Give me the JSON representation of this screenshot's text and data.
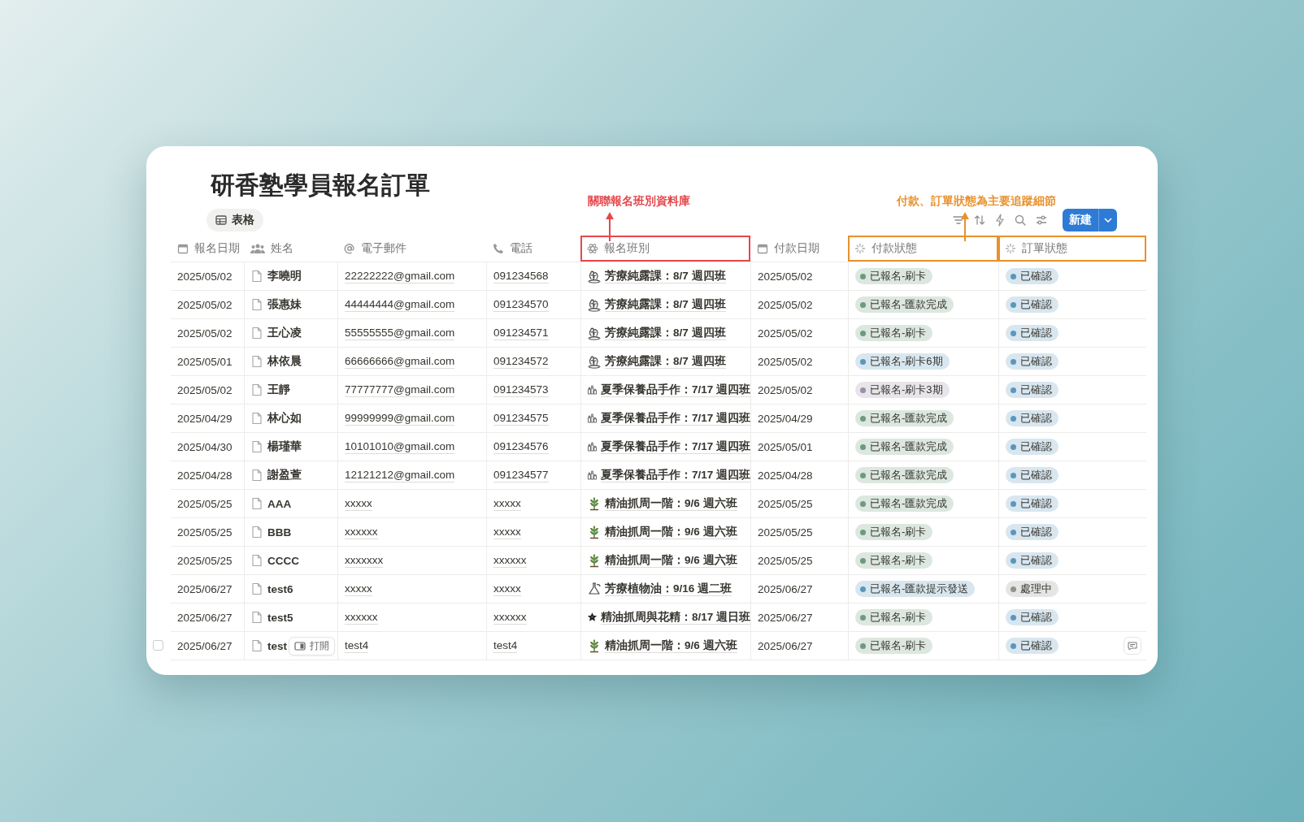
{
  "title": "研香塾學員報名訂單",
  "view_tab": {
    "label": "表格",
    "selected": true
  },
  "annotations": [
    {
      "text": "關聯報名班別資料庫",
      "color": "#e5484d"
    },
    {
      "text": "付款、訂單狀態為主要追蹤細節",
      "color": "#e8912d"
    }
  ],
  "new_button": {
    "label": "新建"
  },
  "columns": [
    {
      "label": "報名日期",
      "kind": "date"
    },
    {
      "label": "姓名",
      "kind": "person"
    },
    {
      "label": "電子郵件",
      "kind": "email"
    },
    {
      "label": "電話",
      "kind": "phone"
    },
    {
      "label": "報名班別",
      "kind": "relation",
      "color": "#e5484d"
    },
    {
      "label": "付款日期",
      "kind": "date"
    },
    {
      "label": "付款狀態",
      "kind": "status",
      "color": "#e8912d"
    },
    {
      "label": "訂單狀態",
      "kind": "status",
      "color": "#e8912d"
    }
  ],
  "rows": [
    {
      "date": "2025/05/02",
      "name": "李曉明",
      "email": "22222222@gmail.com",
      "phone": "091234568",
      "class": {
        "text": "芳療純露課：8/7 週四班",
        "kind": "herbs"
      },
      "pay_date": "2025/05/02",
      "pay_status": {
        "text": "已報名-刷卡",
        "color": "#6c9b7d"
      },
      "order_status": {
        "text": "已確認",
        "color": "#5b97bd"
      }
    },
    {
      "date": "2025/05/02",
      "name": "張惠妹",
      "email": "44444444@gmail.com",
      "phone": "091234570",
      "class": {
        "text": "芳療純露課：8/7 週四班",
        "kind": "herbs"
      },
      "pay_date": "2025/05/02",
      "pay_status": {
        "text": "已報名-匯款完成",
        "color": "#6c9b7d"
      },
      "order_status": {
        "text": "已確認",
        "color": "#5b97bd"
      }
    },
    {
      "date": "2025/05/02",
      "name": "王心凌",
      "email": "55555555@gmail.com",
      "phone": "091234571",
      "class": {
        "text": "芳療純露課：8/7 週四班",
        "kind": "herbs"
      },
      "pay_date": "2025/05/02",
      "pay_status": {
        "text": "已報名-刷卡",
        "color": "#6c9b7d"
      },
      "order_status": {
        "text": "已確認",
        "color": "#5b97bd"
      }
    },
    {
      "date": "2025/05/01",
      "name": "林依晨",
      "email": "66666666@gmail.com",
      "phone": "091234572",
      "class": {
        "text": "芳療純露課：8/7 週四班",
        "kind": "herbs"
      },
      "pay_date": "2025/05/02",
      "pay_status": {
        "text": "已報名-刷卡6期",
        "color": "#5b97bd"
      },
      "order_status": {
        "text": "已確認",
        "color": "#5b97bd"
      }
    },
    {
      "date": "2025/05/02",
      "name": "王靜",
      "email": "77777777@gmail.com",
      "phone": "091234573",
      "class": {
        "text": "夏季保養品手作：7/17 週四班",
        "kind": "bottles"
      },
      "pay_date": "2025/05/02",
      "pay_status": {
        "text": "已報名-刷卡3期",
        "color": "#9a8fa8"
      },
      "order_status": {
        "text": "已確認",
        "color": "#5b97bd"
      }
    },
    {
      "date": "2025/04/29",
      "name": "林心如",
      "email": "99999999@gmail.com",
      "phone": "091234575",
      "class": {
        "text": "夏季保養品手作：7/17 週四班",
        "kind": "bottles"
      },
      "pay_date": "2025/04/29",
      "pay_status": {
        "text": "已報名-匯款完成",
        "color": "#6c9b7d"
      },
      "order_status": {
        "text": "已確認",
        "color": "#5b97bd"
      }
    },
    {
      "date": "2025/04/30",
      "name": "楊瑾華",
      "email": "10101010@gmail.com",
      "phone": "091234576",
      "class": {
        "text": "夏季保養品手作：7/17 週四班",
        "kind": "bottles"
      },
      "pay_date": "2025/05/01",
      "pay_status": {
        "text": "已報名-匯款完成",
        "color": "#6c9b7d"
      },
      "order_status": {
        "text": "已確認",
        "color": "#5b97bd"
      }
    },
    {
      "date": "2025/04/28",
      "name": "謝盈萱",
      "email": "12121212@gmail.com",
      "phone": "091234577",
      "class": {
        "text": "夏季保養品手作：7/17 週四班",
        "kind": "bottles"
      },
      "pay_date": "2025/04/28",
      "pay_status": {
        "text": "已報名-匯款完成",
        "color": "#6c9b7d"
      },
      "order_status": {
        "text": "已確認",
        "color": "#5b97bd"
      }
    },
    {
      "date": "2025/05/25",
      "name": "AAA",
      "email": "xxxxx",
      "phone": "xxxxx",
      "class": {
        "text": "精油抓周一階：9/6 週六班",
        "kind": "plant"
      },
      "pay_date": "2025/05/25",
      "pay_status": {
        "text": "已報名-匯款完成",
        "color": "#6c9b7d"
      },
      "order_status": {
        "text": "已確認",
        "color": "#5b97bd"
      }
    },
    {
      "date": "2025/05/25",
      "name": "BBB",
      "email": "xxxxxx",
      "phone": "xxxxx",
      "class": {
        "text": "精油抓周一階：9/6 週六班",
        "kind": "plant"
      },
      "pay_date": "2025/05/25",
      "pay_status": {
        "text": "已報名-刷卡",
        "color": "#6c9b7d"
      },
      "order_status": {
        "text": "已確認",
        "color": "#5b97bd"
      }
    },
    {
      "date": "2025/05/25",
      "name": "CCCC",
      "email": "xxxxxxx",
      "phone": "xxxxxx",
      "class": {
        "text": "精油抓周一階：9/6 週六班",
        "kind": "plant"
      },
      "pay_date": "2025/05/25",
      "pay_status": {
        "text": "已報名-刷卡",
        "color": "#6c9b7d"
      },
      "order_status": {
        "text": "已確認",
        "color": "#5b97bd"
      }
    },
    {
      "date": "2025/06/27",
      "name": "test6",
      "email": "xxxxx",
      "phone": "xxxxx",
      "class": {
        "text": "芳療植物油：9/16 週二班",
        "kind": "flask"
      },
      "pay_date": "2025/06/27",
      "pay_status": {
        "text": "已報名-匯款提示發送",
        "color": "#5b97bd"
      },
      "order_status": {
        "text": "處理中",
        "color": "#91918e"
      }
    },
    {
      "date": "2025/06/27",
      "name": "test5",
      "email": "xxxxxx",
      "phone": "xxxxxx",
      "class": {
        "text": "精油抓周與花精：8/17 週日班",
        "kind": "flower"
      },
      "pay_date": "2025/06/27",
      "pay_status": {
        "text": "已報名-刷卡",
        "color": "#6c9b7d"
      },
      "order_status": {
        "text": "已確認",
        "color": "#5b97bd"
      }
    },
    {
      "date": "2025/06/27",
      "name": "test",
      "email": "test4",
      "phone": "test4",
      "class": {
        "text": "精油抓周一階：9/6 週六班",
        "kind": "plant"
      },
      "pay_date": "2025/06/27",
      "pay_status": {
        "text": "已報名-刷卡",
        "color": "#6c9b7d"
      },
      "order_status": {
        "text": "已確認",
        "color": "#5b97bd"
      },
      "hover": {
        "checked": false,
        "open_label": "打開"
      }
    }
  ]
}
